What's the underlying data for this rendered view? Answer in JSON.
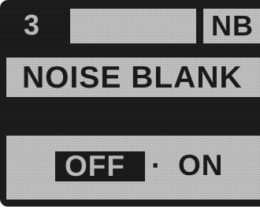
{
  "header": {
    "menu_number": "3",
    "tag": "NB"
  },
  "title": "NOISE BLANK",
  "options": {
    "off_label": "OFF",
    "separator": "·",
    "on_label": "ON",
    "selected": "OFF"
  },
  "colors": {
    "lcd_background": "#b9b9b9",
    "lcd_dark": "#1a1a1a"
  }
}
